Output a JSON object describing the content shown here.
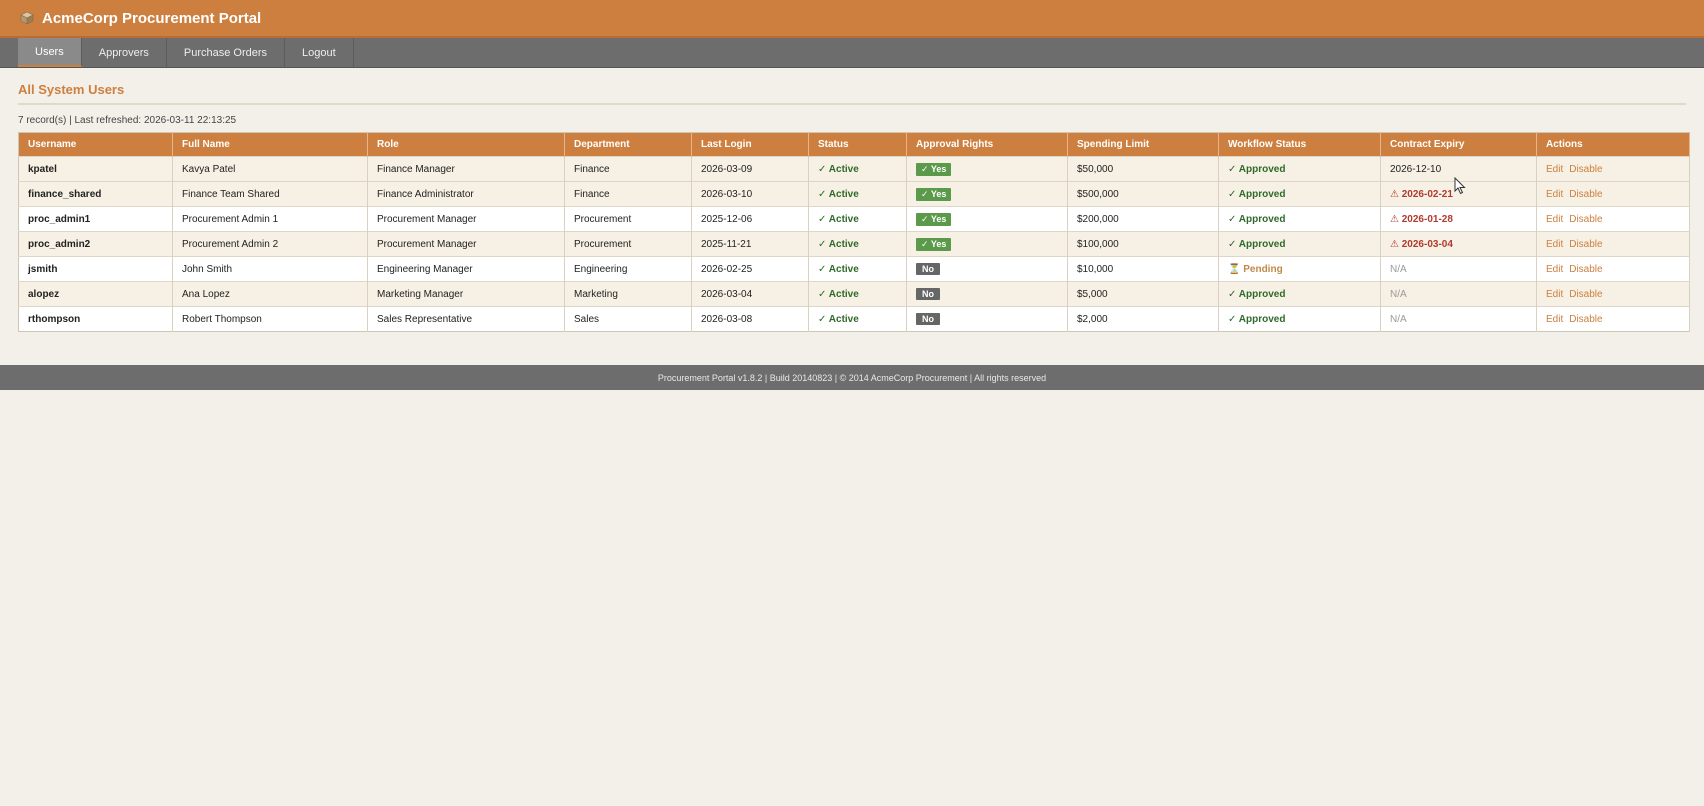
{
  "app": {
    "title": "AcmeCorp Procurement Portal"
  },
  "nav": {
    "tabs": [
      {
        "label": "Users",
        "active": true
      },
      {
        "label": "Approvers",
        "active": false
      },
      {
        "label": "Purchase Orders",
        "active": false
      },
      {
        "label": "Logout",
        "active": false
      }
    ]
  },
  "page": {
    "title": "All System Users",
    "meta": "7 record(s) | Last refreshed: 2026-03-11 22:13:25"
  },
  "table": {
    "headers": [
      "Username",
      "Full Name",
      "Role",
      "Department",
      "Last Login",
      "Status",
      "Approval Rights",
      "Spending Limit",
      "Workflow Status",
      "Contract Expiry",
      "Actions"
    ],
    "rows": [
      {
        "username": "kpatel",
        "full_name": "Kavya Patel",
        "role": "Finance Manager",
        "department": "Finance",
        "last_login": "2026-03-09",
        "status": "✓ Active",
        "approval": "✓ Yes",
        "approval_type": "yes",
        "limit": "$50,000",
        "workflow": "✓ Approved",
        "workflow_type": "ok",
        "expiry": "2026-12-10",
        "expiry_type": "normal",
        "edit": "Edit",
        "disable": "Disable"
      },
      {
        "username": "finance_shared",
        "full_name": "Finance Team Shared",
        "role": "Finance Administrator",
        "department": "Finance",
        "last_login": "2026-03-10",
        "status": "✓ Active",
        "approval": "✓ Yes",
        "approval_type": "yes",
        "limit": "$500,000",
        "workflow": "✓ Approved",
        "workflow_type": "ok",
        "expiry": "⚠ 2026-02-21",
        "expiry_type": "warn",
        "edit": "Edit",
        "disable": "Disable"
      },
      {
        "username": "proc_admin1",
        "full_name": "Procurement Admin 1",
        "role": "Procurement Manager",
        "department": "Procurement",
        "last_login": "2025-12-06",
        "status": "✓ Active",
        "approval": "✓ Yes",
        "approval_type": "yes",
        "limit": "$200,000",
        "workflow": "✓ Approved",
        "workflow_type": "ok",
        "expiry": "⚠ 2026-01-28",
        "expiry_type": "warn",
        "edit": "Edit",
        "disable": "Disable"
      },
      {
        "username": "proc_admin2",
        "full_name": "Procurement Admin 2",
        "role": "Procurement Manager",
        "department": "Procurement",
        "last_login": "2025-11-21",
        "status": "✓ Active",
        "approval": "✓ Yes",
        "approval_type": "yes",
        "limit": "$100,000",
        "workflow": "✓ Approved",
        "workflow_type": "ok",
        "expiry": "⚠ 2026-03-04",
        "expiry_type": "warn",
        "edit": "Edit",
        "disable": "Disable"
      },
      {
        "username": "jsmith",
        "full_name": "John Smith",
        "role": "Engineering Manager",
        "department": "Engineering",
        "last_login": "2026-02-25",
        "status": "✓ Active",
        "approval": "No",
        "approval_type": "no",
        "limit": "$10,000",
        "workflow": "⏳ Pending",
        "workflow_type": "pending",
        "expiry": "N/A",
        "expiry_type": "muted",
        "edit": "Edit",
        "disable": "Disable"
      },
      {
        "username": "alopez",
        "full_name": "Ana Lopez",
        "role": "Marketing Manager",
        "department": "Marketing",
        "last_login": "2026-03-04",
        "status": "✓ Active",
        "approval": "No",
        "approval_type": "no",
        "limit": "$5,000",
        "workflow": "✓ Approved",
        "workflow_type": "ok",
        "expiry": "N/A",
        "expiry_type": "muted",
        "edit": "Edit",
        "disable": "Disable"
      },
      {
        "username": "rthompson",
        "full_name": "Robert Thompson",
        "role": "Sales Representative",
        "department": "Sales",
        "last_login": "2026-03-08",
        "status": "✓ Active",
        "approval": "No",
        "approval_type": "no",
        "limit": "$2,000",
        "workflow": "✓ Approved",
        "workflow_type": "ok",
        "expiry": "N/A",
        "expiry_type": "muted",
        "edit": "Edit",
        "disable": "Disable"
      }
    ]
  },
  "footer": {
    "text": "Procurement Portal v1.8.2 | Build 20140823 | © 2014 AcmeCorp Procurement | All rights reserved"
  },
  "colors": {
    "brand": "#cd7f3f",
    "nav": "#6d6d6d",
    "success": "#2f6a2a",
    "warning": "#b03a2e"
  }
}
